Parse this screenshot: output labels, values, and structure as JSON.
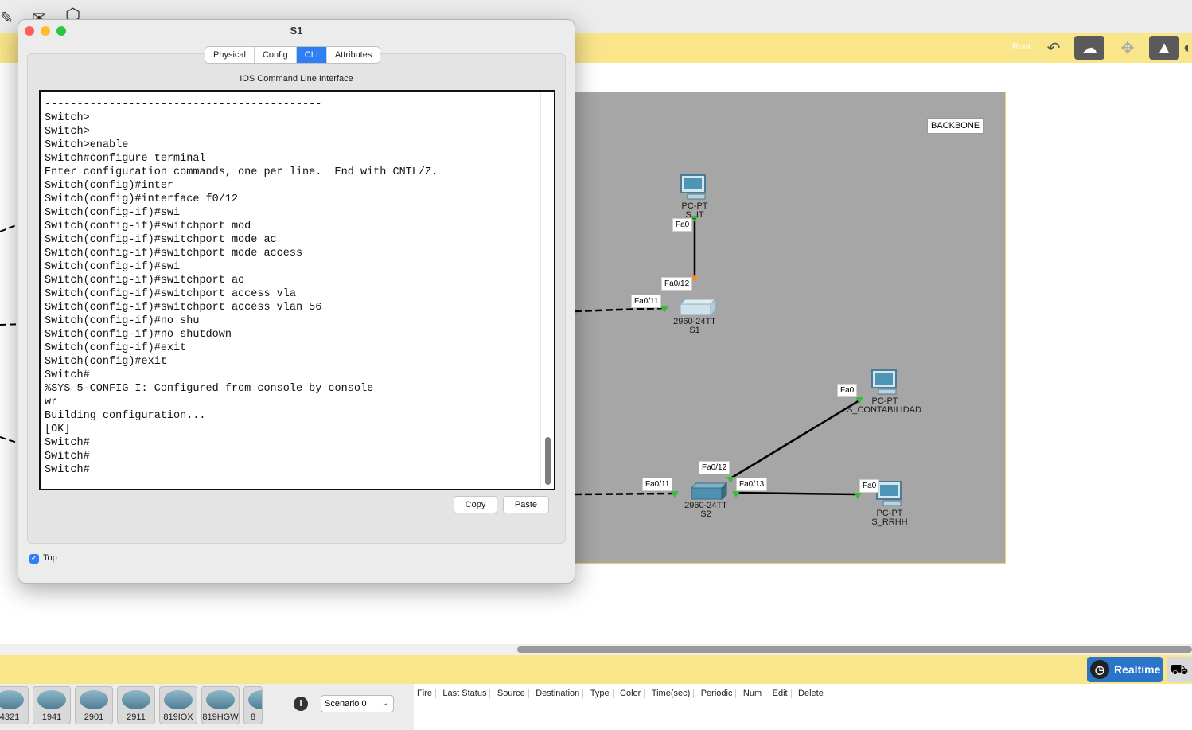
{
  "window": {
    "title": "S1",
    "tabs": [
      {
        "label": "Physical"
      },
      {
        "label": "Config"
      },
      {
        "label": "CLI"
      },
      {
        "label": "Attributes"
      }
    ],
    "selected_tab": "CLI",
    "cli_title": "IOS Command Line Interface",
    "terminal_lines": "------- ---------- -----------------\n-------------------------------------------\nSwitch>\nSwitch>\nSwitch>enable\nSwitch#configure terminal\nEnter configuration commands, one per line.  End with CNTL/Z.\nSwitch(config)#inter\nSwitch(config)#interface f0/12\nSwitch(config-if)#swi\nSwitch(config-if)#switchport mod\nSwitch(config-if)#switchport mode ac\nSwitch(config-if)#switchport mode access\nSwitch(config-if)#swi\nSwitch(config-if)#switchport ac\nSwitch(config-if)#switchport access vla\nSwitch(config-if)#switchport access vlan 56\nSwitch(config-if)#no shu\nSwitch(config-if)#no shutdown\nSwitch(config-if)#exit\nSwitch(config)#exit\nSwitch#\n%SYS-5-CONFIG_I: Configured from console by console\nwr\nBuilding configuration...\n[OK]\nSwitch#\nSwitch#\nSwitch#",
    "copy_label": "Copy",
    "paste_label": "Paste",
    "top_label": "Top",
    "top_checked": true
  },
  "toolbar": {
    "root_label": "Root"
  },
  "topology": {
    "backbone_label": "BACKBONE",
    "devices": {
      "pc_it": {
        "model": "PC-PT",
        "name": "S_IT"
      },
      "s1": {
        "model": "2960-24TT",
        "name": "S1"
      },
      "pc_contabilidad": {
        "model": "PC-PT",
        "name": "S_CONTABILIDAD"
      },
      "s2": {
        "model": "2960-24TT",
        "name": "S2"
      },
      "pc_rrhh": {
        "model": "PC-PT",
        "name": "S_RRHH"
      }
    },
    "ports": {
      "it_fa0": "Fa0",
      "s1_fa012": "Fa0/12",
      "s1_fa011": "Fa0/11",
      "cont_fa0": "Fa0",
      "s2_fa012": "Fa0/12",
      "s2_fa011": "Fa0/11",
      "s2_fa013": "Fa0/13",
      "rrhh_fa0": "Fa0"
    }
  },
  "bottom": {
    "realtime_label": "Realtime",
    "scenario_label": "Scenario 0",
    "device_buttons": [
      "4321",
      "1941",
      "2901",
      "2911",
      "819IOX",
      "819HGW",
      "8"
    ],
    "pdu_columns": [
      "Fire",
      "Last Status",
      "Source",
      "Destination",
      "Type",
      "Color",
      "Time(sec)",
      "Periodic",
      "Num",
      "Edit",
      "Delete"
    ]
  },
  "colors": {
    "accent": "#2f7ff3",
    "toolbar_yellow": "#f9e58a",
    "canvas_gray": "#a6a6a6",
    "realtime_blue": "#2a74c9"
  }
}
